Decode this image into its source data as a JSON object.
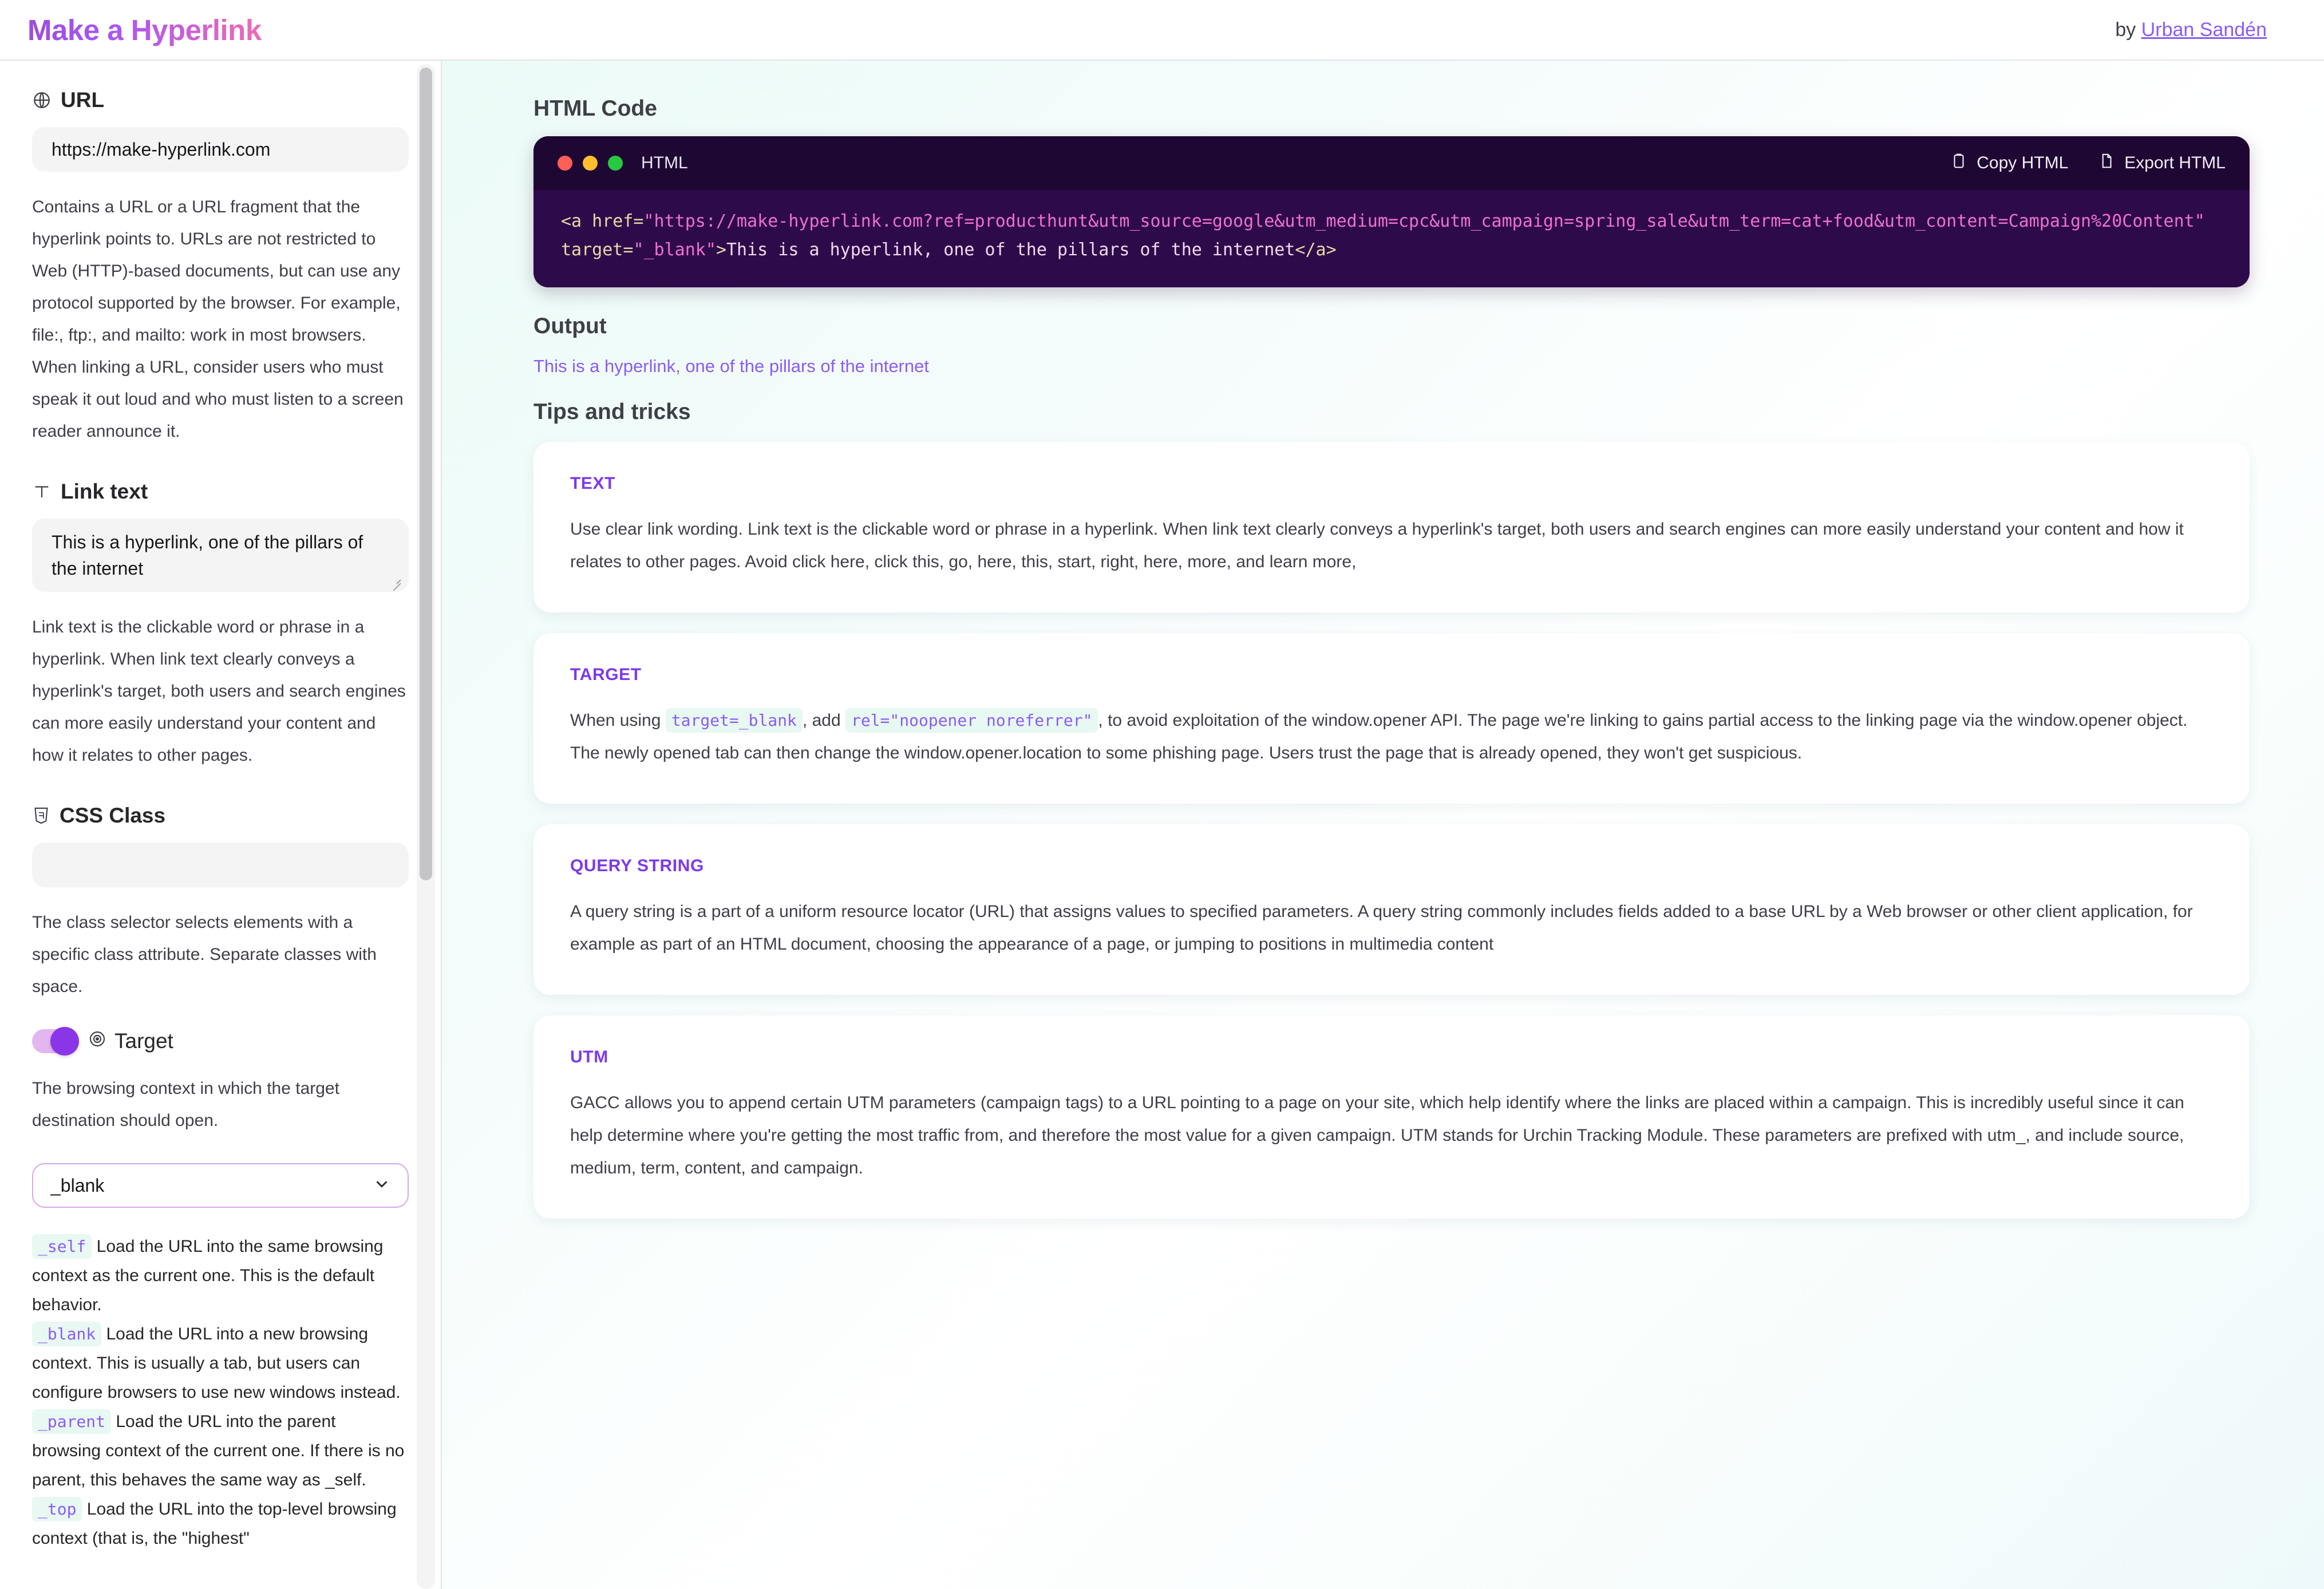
{
  "header": {
    "title": "Make a Hyperlink",
    "by_prefix": "by ",
    "author": "Urban Sandén",
    "accent_start": "#9b4ddb",
    "accent_end": "#ef6bb4"
  },
  "sidebar": {
    "url": {
      "icon": "globe-icon",
      "label": "URL",
      "value": "https://make-hyperlink.com",
      "help": "Contains a URL or a URL fragment that the hyperlink points to. URLs are not restricted to Web (HTTP)-based documents, but can use any protocol supported by the browser. For example, file:, ftp:, and mailto: work in most browsers. When linking a URL, consider users who must speak it out loud and who must listen to a screen reader announce it."
    },
    "link_text": {
      "icon": "text-icon",
      "label": "Link text",
      "value": "This is a hyperlink, one of the pillars of the internet",
      "help": "Link text is the clickable word or phrase in a hyperlink. When link text clearly conveys a hyperlink's target, both users and search engines can more easily understand your content and how it relates to other pages."
    },
    "css_class": {
      "icon": "css3-shield-icon",
      "label": "CSS Class",
      "value": "",
      "help": "The class selector selects elements with a specific class attribute. Separate classes with space."
    },
    "target": {
      "icon": "target-icon",
      "label": "Target",
      "toggle_on": true,
      "help": "The browsing context in which the target destination should open.",
      "selected": "_blank",
      "options": [
        "_self",
        "_blank",
        "_parent",
        "_top"
      ],
      "docs": [
        {
          "code": "_self",
          "text": "Load the URL into the same browsing context as the current one. This is the default behavior."
        },
        {
          "code": "_blank",
          "text": "Load the URL into a new browsing context. This is usually a tab, but users can configure browsers to use new windows instead."
        },
        {
          "code": "_parent",
          "text": "Load the URL into the parent browsing context of the current one. If there is no parent, this behaves the same way as _self."
        },
        {
          "code": "_top",
          "text": "Load the URL into the top-level browsing context (that is, the \"highest\""
        }
      ]
    }
  },
  "main": {
    "html_code_heading": "HTML Code",
    "code_window": {
      "language": "HTML",
      "copy_label": "Copy HTML",
      "export_label": "Export HTML",
      "tag_open": "<a href=",
      "url_string": "\"https://make-hyperlink.com?ref=producthunt&utm_source=google&utm_medium=cpc&utm_campaign=spring_sale&utm_term=cat+food&utm_content=Campaign%20Content\"",
      "target_attr": " target=",
      "target_value": "\"_blank\"",
      "gt": ">",
      "link_text": "This is a hyperlink, one of the pillars of the internet",
      "tag_close": "</a>"
    },
    "output_heading": "Output",
    "output_link_text": "This is a hyperlink, one of the pillars of the internet",
    "tips_heading": "Tips and tricks",
    "tips": [
      {
        "title": "TEXT",
        "body": "Use clear link wording. Link text is the clickable word or phrase in a hyperlink. When link text clearly conveys a hyperlink's target, both users and search engines can more easily understand your content and how it relates to other pages. Avoid click here, click this, go, here, this, start, right, here, more, and learn more,"
      },
      {
        "title": "TARGET",
        "body_pre": "When using ",
        "code1": "target=_blank",
        "body_mid": ", add ",
        "code2": "rel=\"noopener noreferrer\"",
        "body_post": ", to avoid exploitation of the window.opener API. The page we're linking to gains partial access to the linking page via the window.opener object. The newly opened tab can then change the window.opener.location to some phishing page. Users trust the page that is already opened, they won't get suspicious."
      },
      {
        "title": "QUERY STRING",
        "body": "A query string is a part of a uniform resource locator (URL) that assigns values to specified parameters. A query string commonly includes fields added to a base URL by a Web browser or other client application, for example as part of an HTML document, choosing the appearance of a page, or jumping to positions in multimedia content"
      },
      {
        "title": "UTM",
        "body": "GACC allows you to append certain UTM parameters (campaign tags) to a URL pointing to a page on your site, which help identify where the links are placed within a campaign. This is incredibly useful since it can help determine where you're getting the most traffic from, and therefore the most value for a given campaign. UTM stands for Urchin Tracking Module. These parameters are prefixed with utm_, and include source, medium, term, content, and campaign."
      }
    ]
  }
}
